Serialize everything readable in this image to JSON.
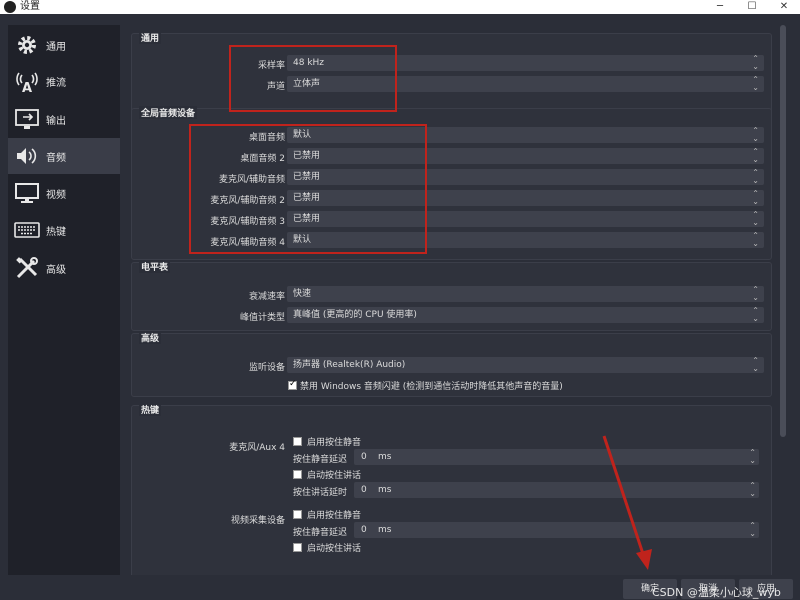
{
  "window": {
    "title": "设置"
  },
  "sidebar": {
    "items": [
      {
        "label": "通用",
        "icon": "gear-icon"
      },
      {
        "label": "推流",
        "icon": "broadcast-antenna-icon"
      },
      {
        "label": "输出",
        "icon": "output-monitor-icon"
      },
      {
        "label": "音频",
        "icon": "speaker-icon",
        "active": true
      },
      {
        "label": "视频",
        "icon": "display-monitor-icon"
      },
      {
        "label": "热键",
        "icon": "keyboard-icon"
      },
      {
        "label": "高级",
        "icon": "tools-icon"
      }
    ]
  },
  "general": {
    "title": "通用",
    "sample_rate_label": "采样率",
    "sample_rate_value": "48 kHz",
    "channels_label": "声道",
    "channels_value": "立体声"
  },
  "global_devices": {
    "title": "全局音频设备",
    "rows": [
      {
        "label": "桌面音频",
        "value": "默认"
      },
      {
        "label": "桌面音频 2",
        "value": "已禁用"
      },
      {
        "label": "麦克风/辅助音频",
        "value": "已禁用"
      },
      {
        "label": "麦克风/辅助音频 2",
        "value": "已禁用"
      },
      {
        "label": "麦克风/辅助音频 3",
        "value": "已禁用"
      },
      {
        "label": "麦克风/辅助音频 4",
        "value": "默认"
      }
    ]
  },
  "meters": {
    "title": "电平表",
    "decay_label": "衰减速率",
    "decay_value": "快速",
    "peak_label": "峰值计类型",
    "peak_value": "真峰值 (更高的的 CPU 使用率)"
  },
  "advanced": {
    "title": "高级",
    "monitor_label": "监听设备",
    "monitor_value": "扬声器 (Realtek(R) Audio)",
    "ducking_label": "禁用 Windows 音频闪避 (检测到通信活动时降低其他声音的音量)",
    "ducking_checked": true
  },
  "hotkeys": {
    "title": "热键",
    "sections": [
      {
        "name": "麦克风/Aux 4",
        "ptm_enable": "启用按住静音",
        "ptm_delay_label": "按住静音延迟",
        "ptm_delay_value": "0",
        "ptt_enable": "启动按住讲话",
        "ptt_delay_label": "按住讲话延时",
        "ptt_delay_value": "0",
        "unit": "ms"
      },
      {
        "name": "视频采集设备",
        "ptm_enable": "启用按住静音",
        "ptm_delay_label": "按住静音延迟",
        "ptm_delay_value": "0",
        "ptt_enable": "启动按住讲话",
        "unit": "ms"
      }
    ]
  },
  "buttons": {
    "ok": "确定",
    "cancel": "取消",
    "apply": "应用"
  },
  "watermark": "CSDN @温柔小心球_wyb",
  "colors": {
    "annotation_red": "#c0231c",
    "background": "#2b2e38",
    "sidebar_bg": "#1f2129"
  }
}
